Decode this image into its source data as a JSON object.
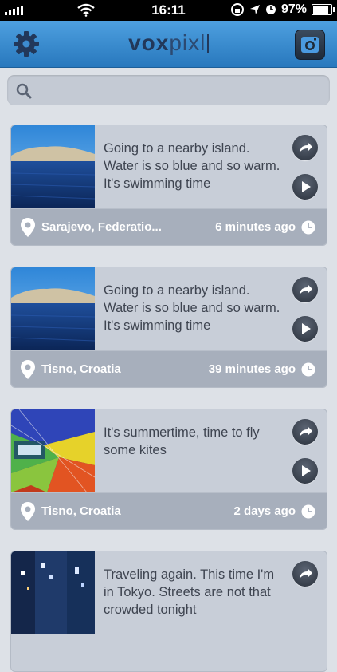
{
  "status_bar": {
    "time": "16:11",
    "battery": "97%",
    "battery_level": 0.97
  },
  "nav": {
    "logo_bold": "vox",
    "logo_light": "pixl",
    "left_icon": "gear-icon",
    "right_icon": "camera-icon"
  },
  "search": {
    "placeholder": ""
  },
  "posts": [
    {
      "text": "Going to a nearby island. Water is so blue and so warm. It's swimming time",
      "location": "Sarajevo, Federatio...",
      "time": "6 minutes ago",
      "image": "sea-island-photo"
    },
    {
      "text": "Going to a nearby island. Water is so blue and so warm. It's swimming time",
      "location": "Tisno, Croatia",
      "time": "39 minutes ago",
      "image": "sea-island-photo"
    },
    {
      "text": "It's summertime, time to fly some kites",
      "location": "Tisno, Croatia",
      "time": "2 days ago",
      "image": "kite-photo"
    },
    {
      "text": "Traveling again. This time I'm in Tokyo. Streets are not that crowded tonight",
      "location": "",
      "time": "",
      "image": "tokyo-street-photo"
    }
  ]
}
